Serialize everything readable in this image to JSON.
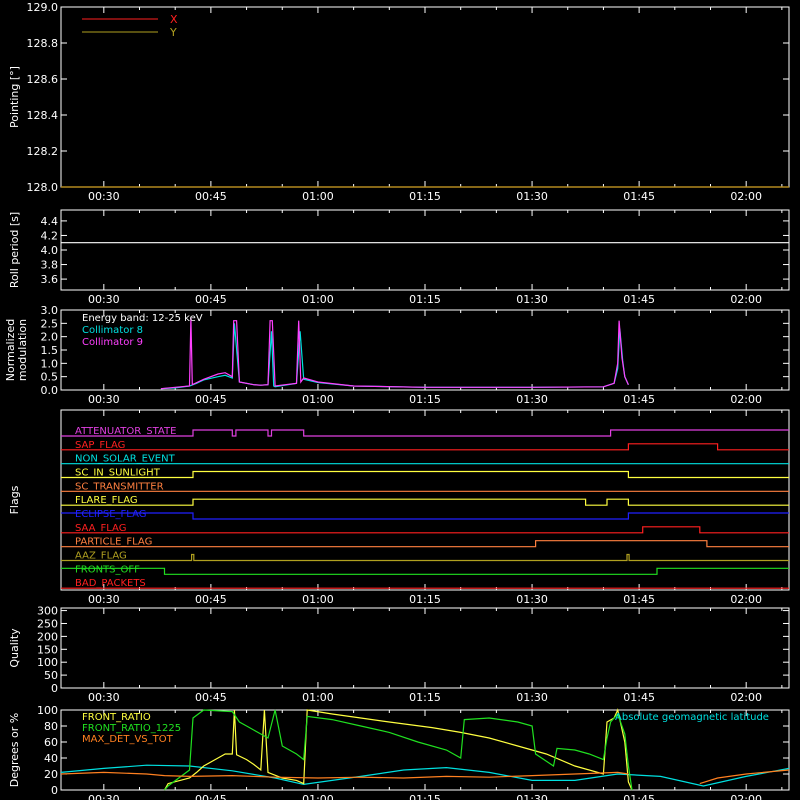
{
  "time_ticks": [
    "00:30",
    "00:45",
    "01:00",
    "01:15",
    "01:30",
    "01:45",
    "02:00"
  ],
  "time_tick_minutes": [
    30,
    45,
    60,
    75,
    90,
    105,
    120
  ],
  "time_range_minutes": [
    24,
    126
  ],
  "chart_data": [
    {
      "id": "pointing",
      "type": "line",
      "ylabel": "Pointing [°]",
      "ylim": [
        128.0,
        129.0
      ],
      "yticks": [
        "128.0",
        "128.2",
        "128.4",
        "128.6",
        "128.8",
        "129.0"
      ],
      "ytick_values": [
        128.0,
        128.2,
        128.4,
        128.6,
        128.8,
        129.0
      ],
      "legend_placement": "top-left",
      "series": [
        {
          "name": "X",
          "color": "#ff2020",
          "x": [
            24,
            126
          ],
          "y": [
            128.0,
            128.0
          ]
        },
        {
          "name": "Y",
          "color": "#b0a020",
          "x": [
            24,
            126
          ],
          "y": [
            128.0,
            128.0
          ]
        }
      ]
    },
    {
      "id": "roll",
      "type": "line",
      "ylabel": "Roll period [s]",
      "ylim": [
        3.45,
        4.55
      ],
      "yticks": [
        "3.6",
        "3.8",
        "4.0",
        "4.2",
        "4.4"
      ],
      "ytick_values": [
        3.6,
        3.8,
        4.0,
        4.2,
        4.4
      ],
      "series": [
        {
          "color": "#ffffff",
          "x": [
            24,
            126
          ],
          "y": [
            4.1,
            4.1
          ]
        }
      ]
    },
    {
      "id": "modulation",
      "type": "line",
      "ylabel": [
        "Normalized",
        "modulation"
      ],
      "ylim": [
        0,
        3.0
      ],
      "yticks": [
        "0.0",
        "0.5",
        "1.0",
        "1.5",
        "2.0",
        "2.5",
        "3.0"
      ],
      "ytick_values": [
        0,
        0.5,
        1.0,
        1.5,
        2.0,
        2.5,
        3.0
      ],
      "annotation": "Energy band: 12-25 keV",
      "legend_placement": "top-left",
      "series": [
        {
          "name": "Collimator 8",
          "color": "#00e0e0",
          "x": [
            24,
            38,
            40,
            42,
            43,
            44,
            46,
            47,
            48,
            48.3,
            49,
            51,
            52,
            53,
            53.5,
            53.8,
            54,
            57,
            57.5,
            58,
            60,
            65,
            75,
            90,
            100,
            101.5,
            102,
            102.3,
            102.7,
            103,
            103.5,
            104,
            126
          ],
          "y": [
            null,
            0.05,
            0.08,
            0.15,
            0.25,
            0.38,
            0.5,
            0.55,
            0.45,
            2.5,
            0.3,
            0.2,
            0.18,
            0.2,
            2.2,
            0.15,
            0.12,
            0.25,
            2.2,
            0.4,
            0.28,
            0.15,
            0.1,
            0.1,
            0.12,
            0.25,
            0.8,
            2.3,
            1.1,
            0.5,
            0.2,
            null,
            null
          ]
        },
        {
          "name": "Collimator 9",
          "color": "#ff40ff",
          "x": [
            24,
            38,
            40,
            42,
            42.2,
            42.4,
            44,
            46,
            47,
            48,
            48.2,
            48.6,
            49,
            51,
            52,
            53,
            53.3,
            53.6,
            54,
            57,
            57.3,
            57.6,
            58,
            60,
            65,
            75,
            90,
            100,
            101.5,
            102,
            102.2,
            102.6,
            103,
            103.5,
            104,
            126
          ],
          "y": [
            null,
            0.05,
            0.1,
            0.15,
            2.7,
            0.2,
            0.4,
            0.6,
            0.65,
            0.5,
            2.6,
            2.6,
            0.3,
            0.2,
            0.18,
            0.2,
            2.6,
            2.6,
            0.15,
            0.25,
            2.6,
            0.3,
            0.45,
            0.3,
            0.15,
            0.1,
            0.1,
            0.12,
            0.25,
            1.0,
            2.6,
            1.2,
            0.5,
            0.2,
            null,
            null
          ]
        }
      ]
    },
    {
      "id": "flags",
      "type": "step",
      "ylabel": "Flags",
      "flags": [
        {
          "name": "ATTENUATOR_STATE",
          "color": "#e040e0",
          "t": [
            24,
            42.5,
            42.5,
            48,
            48,
            48.5,
            48.5,
            53,
            53,
            53.5,
            53.5,
            58,
            58,
            101,
            101,
            126
          ],
          "v": [
            0,
            0,
            1,
            1,
            0,
            0,
            1,
            1,
            0,
            0,
            1,
            1,
            0,
            0,
            1,
            1
          ]
        },
        {
          "name": "SAP_FLAG",
          "color": "#ff2020",
          "t": [
            24,
            103.5,
            103.5,
            116,
            116,
            126
          ],
          "v": [
            0,
            0,
            1,
            1,
            0,
            0
          ]
        },
        {
          "name": "NON_SOLAR_EVENT",
          "color": "#00e0e0",
          "t": [
            24,
            126
          ],
          "v": [
            0,
            0
          ]
        },
        {
          "name": "SC_IN_SUNLIGHT",
          "color": "#ffff40",
          "t": [
            24,
            42.5,
            42.5,
            103.5,
            103.5,
            126
          ],
          "v": [
            0,
            0,
            1,
            1,
            0,
            0
          ]
        },
        {
          "name": "SC_TRANSMITTER",
          "color": "#ff8040",
          "t": [
            24,
            126
          ],
          "v": [
            0,
            0
          ]
        },
        {
          "name": "FLARE_FLAG",
          "color": "#ffff40",
          "t": [
            24,
            42.5,
            42.5,
            97.5,
            97.5,
            100.5,
            100.5,
            103.5,
            103.5,
            126
          ],
          "v": [
            0,
            0,
            1,
            1,
            0,
            0,
            1,
            1,
            0,
            0
          ]
        },
        {
          "name": "ECLIPSE_FLAG",
          "color": "#2020ff",
          "t": [
            24,
            42.5,
            42.5,
            103.5,
            103.5,
            126
          ],
          "v": [
            1,
            1,
            0,
            0,
            1,
            1
          ]
        },
        {
          "name": "SAA_FLAG",
          "color": "#ff2020",
          "t": [
            24,
            105.5,
            105.5,
            113.5,
            113.5,
            126
          ],
          "v": [
            0,
            0,
            1,
            1,
            0,
            0
          ]
        },
        {
          "name": "PARTICLE_FLAG",
          "color": "#ff8040",
          "t": [
            24,
            90.5,
            90.5,
            114.5,
            114.5,
            126
          ],
          "v": [
            0,
            0,
            1,
            1,
            0,
            0
          ]
        },
        {
          "name": "AAZ_FLAG",
          "color": "#b0a020",
          "t": [
            24,
            42.3,
            42.3,
            42.6,
            42.6,
            103.3,
            103.3,
            103.6,
            103.6,
            126
          ],
          "v": [
            0,
            0,
            1,
            1,
            0,
            0,
            1,
            1,
            0,
            0
          ]
        },
        {
          "name": "FRONTS_OFF",
          "color": "#20e020",
          "t": [
            24,
            38.5,
            38.5,
            107.5,
            107.5,
            126
          ],
          "v": [
            1,
            1,
            0,
            0,
            1,
            1
          ]
        },
        {
          "name": "BAD_PACKETS",
          "color": "#ff2020",
          "t": [
            24,
            126
          ],
          "v": [
            0,
            0
          ]
        }
      ]
    },
    {
      "id": "quality",
      "type": "line",
      "ylabel": "Quality",
      "ylim": [
        0,
        310
      ],
      "yticks": [
        "0",
        "50",
        "100",
        "150",
        "200",
        "250",
        "300"
      ],
      "ytick_values": [
        0,
        50,
        100,
        150,
        200,
        250,
        300
      ],
      "series": []
    },
    {
      "id": "ratios",
      "type": "line",
      "ylabel": "Degrees or %",
      "ylim": [
        0,
        100
      ],
      "yticks": [
        "0",
        "20",
        "40",
        "60",
        "80",
        "100"
      ],
      "ytick_values": [
        0,
        20,
        40,
        60,
        80,
        100
      ],
      "legend_placement": "top-left",
      "series": [
        {
          "name": "Absolute geomagnetic latitude",
          "color": "#00e0e0",
          "x": [
            24,
            30,
            36,
            42,
            48,
            54,
            58,
            66,
            72,
            78,
            84,
            90,
            96,
            102,
            108,
            114,
            120,
            126
          ],
          "y": [
            22,
            27,
            31,
            30,
            24,
            15,
            7,
            17,
            25,
            28,
            22,
            12,
            12,
            20,
            17,
            5,
            17,
            27
          ]
        },
        {
          "name": "FRONT_RATIO",
          "color": "#ffff40",
          "x": [
            24,
            38.5,
            39,
            42,
            43,
            44,
            46,
            47,
            48,
            48.3,
            48.6,
            50,
            51,
            52,
            52.5,
            53,
            55,
            57,
            58,
            58.5,
            62,
            66,
            70,
            76,
            80,
            84,
            88,
            92,
            96,
            100,
            100.5,
            101.5,
            102,
            103,
            103.5,
            104,
            126
          ],
          "y": [
            null,
            0,
            8,
            15,
            22,
            30,
            40,
            45,
            45,
            100,
            44,
            38,
            32,
            25,
            100,
            22,
            15,
            12,
            8,
            100,
            95,
            90,
            85,
            78,
            72,
            65,
            55,
            45,
            30,
            20,
            85,
            90,
            100,
            60,
            10,
            0,
            null
          ]
        },
        {
          "name": "FRONT_RATIO_1225",
          "color": "#20e020",
          "x": [
            24,
            38.5,
            39,
            42,
            42.5,
            44,
            48,
            49,
            50,
            51,
            52,
            53,
            54,
            55,
            56,
            57,
            58,
            58.5,
            62,
            66,
            70,
            74,
            78,
            80,
            80.5,
            84,
            88,
            90,
            90.5,
            93,
            93.5,
            96,
            98,
            100,
            100.5,
            101,
            102,
            103,
            103.5,
            104,
            126
          ],
          "y": [
            null,
            0,
            5,
            25,
            90,
            100,
            98,
            85,
            80,
            75,
            70,
            65,
            100,
            55,
            50,
            45,
            38,
            92,
            88,
            80,
            72,
            60,
            50,
            40,
            88,
            90,
            85,
            80,
            45,
            30,
            52,
            50,
            45,
            38,
            65,
            85,
            95,
            70,
            30,
            0,
            null
          ]
        },
        {
          "name": "MAX_DET_VS_TOT",
          "color": "#ff8020",
          "x": [
            24,
            30,
            36,
            38.5,
            42,
            48,
            54,
            60,
            66,
            72,
            78,
            84,
            90,
            96,
            102,
            103.5,
            104,
            113,
            113.5,
            116,
            120,
            126
          ],
          "y": [
            20,
            22,
            20,
            18,
            17,
            18,
            16,
            15,
            16,
            15,
            17,
            16,
            18,
            20,
            22,
            20,
            null,
            null,
            8,
            15,
            20,
            25
          ]
        }
      ]
    }
  ]
}
